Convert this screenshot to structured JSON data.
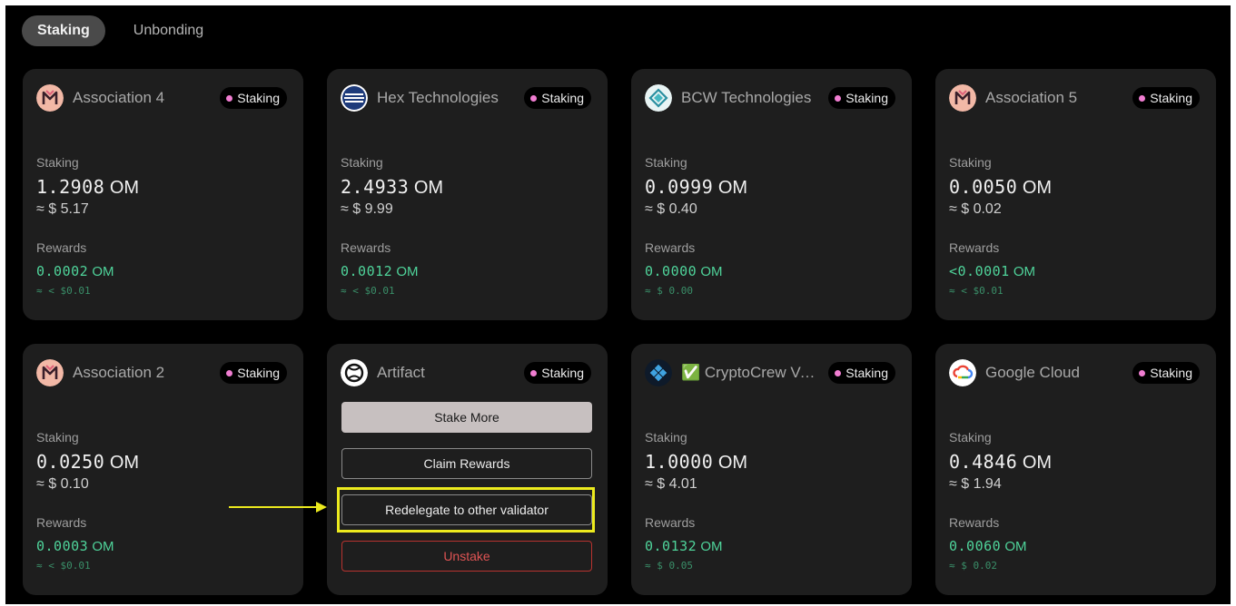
{
  "tabs": [
    {
      "label": "Staking",
      "active": true
    },
    {
      "label": "Unbonding",
      "active": false
    }
  ],
  "labels": {
    "staking": "Staking",
    "rewards": "Rewards",
    "badge": "Staking",
    "unit": "OM"
  },
  "cards": [
    {
      "name": "Association 4",
      "logo": "mantra-logo",
      "staking": "1.2908",
      "usd": "≈ $ 5.17",
      "rewards": "0.0002",
      "rewards_usd": "≈ < $0.01"
    },
    {
      "name": "Hex Technologies",
      "logo": "hex-logo",
      "staking": "2.4933",
      "usd": "≈ $ 9.99",
      "rewards": "0.0012",
      "rewards_usd": "≈ < $0.01"
    },
    {
      "name": "BCW Technologies",
      "logo": "bcw-logo",
      "staking": "0.0999",
      "usd": "≈ $ 0.40",
      "rewards": "0.0000",
      "rewards_usd": "≈ $ 0.00"
    },
    {
      "name": "Association 5",
      "logo": "mantra-logo",
      "staking": "0.0050",
      "usd": "≈ $ 0.02",
      "rewards": "<0.0001",
      "rewards_usd": "≈ < $0.01"
    },
    {
      "name": "Association 2",
      "logo": "mantra-logo",
      "staking": "0.0250",
      "usd": "≈ $ 0.10",
      "rewards": "0.0003",
      "rewards_usd": "≈ < $0.01"
    },
    {
      "name": "Artifact",
      "logo": "artifact-logo",
      "actions": {
        "stake_more": "Stake More",
        "claim_rewards": "Claim Rewards",
        "redelegate": "Redelegate to other validator",
        "unstake": "Unstake"
      }
    },
    {
      "name": "✅ CryptoCrew Va...",
      "logo": "cryptocrew-logo",
      "staking": "1.0000",
      "usd": "≈ $ 4.01",
      "rewards": "0.0132",
      "rewards_usd": "≈ $ 0.05"
    },
    {
      "name": "Google Cloud",
      "logo": "google-cloud-logo",
      "staking": "0.4846",
      "usd": "≈ $ 1.94",
      "rewards": "0.0060",
      "rewards_usd": "≈ $ 0.02"
    }
  ],
  "colors": {
    "background": "#000000",
    "card": "#1e1e1e",
    "status_dot": "#f07dd1",
    "reward": "#4fd39a",
    "danger": "#e05454",
    "highlight": "#ecea1e"
  }
}
